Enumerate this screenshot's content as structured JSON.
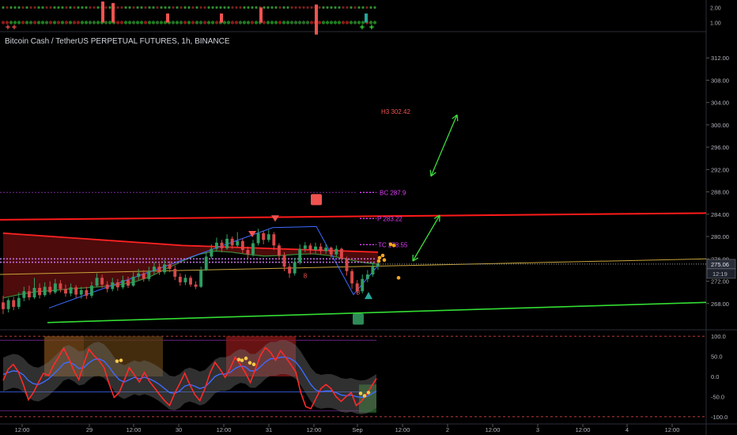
{
  "header": {
    "title": "Bitcoin Cash / TetherUS PERPETUAL FUTURES, 1h, BINANCE"
  },
  "colors": {
    "up": "#26a69a",
    "down": "#ef5350",
    "background": "#000000",
    "pivot": "#e040fb",
    "h3": "#ef5350",
    "ema_long": "#ff1a1a",
    "trend_yellow": "#c8a43a",
    "trend_green": "#33dd33",
    "rsi": "#ff2a2a",
    "rsi_signal": "#3d6bff"
  },
  "chart_data": [
    {
      "type": "bar",
      "name": "indicator-strip",
      "ylim": [
        0.5,
        2.5
      ],
      "y_ticks": [
        "2.00",
        "1.00"
      ],
      "plus_markers": [
        "+",
        "+",
        "+",
        "+"
      ]
    },
    {
      "type": "candlestick",
      "title": "Bitcoin Cash / TetherUS PERPETUAL FUTURES, 1h, BINANCE",
      "ylim": [
        264,
        315
      ],
      "y_ticks": [
        "312.00",
        "308.00",
        "304.00",
        "300.00",
        "296.00",
        "292.00",
        "288.00",
        "284.00",
        "280.00",
        "276.00",
        "272.00",
        "268.00"
      ],
      "x_ticks": [
        "12:00",
        "29",
        "12:00",
        "30",
        "12:00",
        "31",
        "12:00",
        "Sep",
        "12:00",
        "2",
        "12:00",
        "3",
        "12:00",
        "4",
        "12:00"
      ],
      "current_price": {
        "value": 275.06,
        "label": "275.06",
        "countdown": "12:19"
      },
      "levels": [
        {
          "label": "H3 302.42",
          "value": 302.42
        },
        {
          "label": "BC 287.9",
          "value": 287.9
        },
        {
          "label": "P 283.22",
          "value": 283.22
        },
        {
          "label": "TC 278.55",
          "value": 278.55
        }
      ],
      "candles": [
        [
          268.2,
          267.0,
          269.4,
          266.1
        ],
        [
          267.0,
          268.6,
          269.0,
          266.4
        ],
        [
          268.6,
          267.4,
          269.2,
          266.8
        ],
        [
          267.4,
          269.0,
          270.0,
          267.0
        ],
        [
          269.0,
          270.2,
          271.0,
          268.4
        ],
        [
          270.2,
          269.1,
          271.2,
          268.6
        ],
        [
          269.1,
          270.8,
          272.6,
          268.8
        ],
        [
          270.8,
          269.5,
          271.6,
          268.9
        ],
        [
          269.5,
          271.0,
          271.8,
          269.2
        ],
        [
          271.0,
          270.0,
          272.0,
          269.6
        ],
        [
          270.0,
          271.6,
          272.4,
          269.7
        ],
        [
          271.6,
          270.6,
          272.2,
          270.0
        ],
        [
          270.6,
          269.8,
          271.4,
          269.2
        ],
        [
          269.8,
          270.9,
          271.6,
          269.3
        ],
        [
          270.9,
          269.6,
          271.3,
          269.0
        ],
        [
          269.6,
          270.4,
          271.0,
          268.9
        ],
        [
          270.4,
          269.4,
          271.0,
          268.8
        ],
        [
          269.4,
          271.2,
          271.9,
          269.0
        ],
        [
          271.2,
          272.6,
          273.4,
          270.9
        ],
        [
          272.6,
          271.4,
          273.2,
          270.8
        ],
        [
          271.4,
          270.6,
          272.0,
          270.0
        ],
        [
          270.6,
          271.8,
          272.6,
          270.2
        ],
        [
          271.8,
          270.9,
          272.4,
          270.3
        ],
        [
          270.9,
          272.2,
          273.0,
          270.6
        ],
        [
          272.2,
          271.2,
          272.8,
          270.8
        ],
        [
          271.2,
          272.8,
          273.6,
          271.0
        ],
        [
          272.8,
          273.4,
          274.2,
          272.2
        ],
        [
          273.4,
          272.4,
          274.0,
          271.9
        ],
        [
          272.4,
          273.8,
          274.6,
          272.0
        ],
        [
          273.8,
          274.6,
          275.4,
          273.2
        ],
        [
          274.6,
          273.6,
          275.2,
          273.1
        ],
        [
          273.6,
          275.0,
          275.8,
          273.2
        ],
        [
          275.0,
          274.2,
          275.6,
          273.6
        ],
        [
          274.2,
          272.8,
          274.8,
          272.2
        ],
        [
          272.8,
          271.8,
          273.4,
          271.2
        ],
        [
          271.8,
          272.6,
          273.2,
          271.3
        ],
        [
          272.6,
          271.4,
          273.0,
          271.0
        ],
        [
          271.4,
          271.0,
          272.0,
          270.6
        ],
        [
          271.0,
          274.0,
          274.6,
          270.8
        ],
        [
          274.0,
          276.4,
          277.2,
          273.8
        ],
        [
          276.4,
          277.8,
          278.6,
          276.0
        ],
        [
          277.8,
          278.9,
          279.8,
          277.3
        ],
        [
          278.9,
          277.9,
          279.4,
          277.2
        ],
        [
          277.9,
          279.6,
          280.4,
          277.6
        ],
        [
          279.6,
          278.4,
          280.0,
          277.8
        ],
        [
          278.4,
          279.2,
          280.8,
          278.0
        ],
        [
          279.2,
          277.6,
          279.6,
          277.0
        ],
        [
          277.6,
          276.8,
          278.2,
          276.0
        ],
        [
          276.8,
          278.8,
          279.4,
          276.4
        ],
        [
          278.8,
          280.6,
          281.4,
          278.4
        ],
        [
          280.6,
          279.4,
          281.0,
          278.6
        ],
        [
          279.4,
          280.4,
          281.2,
          279.0
        ],
        [
          280.4,
          278.4,
          280.8,
          277.6
        ],
        [
          278.4,
          276.6,
          278.8,
          275.8
        ],
        [
          276.6,
          274.6,
          277.2,
          273.8
        ],
        [
          274.6,
          273.4,
          275.2,
          272.6
        ],
        [
          273.4,
          275.4,
          276.2,
          273.0
        ],
        [
          275.4,
          277.8,
          278.6,
          275.0
        ],
        [
          277.8,
          278.4,
          279.0,
          277.2
        ],
        [
          278.4,
          277.6,
          278.8,
          276.8
        ],
        [
          277.6,
          278.2,
          278.9,
          277.0
        ],
        [
          278.2,
          277.4,
          278.8,
          276.8
        ],
        [
          277.4,
          278.0,
          278.6,
          276.9
        ],
        [
          278.0,
          276.8,
          278.2,
          276.2
        ],
        [
          276.8,
          277.8,
          278.4,
          276.4
        ],
        [
          277.8,
          276.0,
          278.0,
          275.4
        ],
        [
          276.0,
          273.8,
          276.4,
          273.0
        ],
        [
          273.8,
          271.6,
          274.2,
          270.6
        ],
        [
          271.6,
          270.2,
          272.2,
          269.6
        ],
        [
          270.2,
          272.4,
          273.2,
          269.8
        ],
        [
          272.4,
          273.2,
          274.0,
          271.8
        ],
        [
          273.2,
          274.6,
          275.4,
          272.8
        ],
        [
          274.6,
          275.2,
          276.0,
          274.0
        ]
      ],
      "ema_long": [
        280.6,
        280.4,
        280.2,
        280.0,
        279.8,
        279.6,
        279.4,
        279.2,
        279.0,
        278.8,
        278.6,
        278.4,
        278.3,
        278.2,
        278.1,
        278.0,
        277.9,
        277.8,
        277.7,
        277.6,
        277.5,
        277.4,
        277.3,
        277.2
      ],
      "ema_mid": [
        269.0,
        269.6,
        270.1,
        270.3,
        270.6,
        270.8,
        271.0,
        271.3,
        271.8,
        272.8,
        274.2,
        275.6,
        276.8,
        277.4,
        277.2,
        276.8,
        276.5,
        276.6,
        276.8,
        276.9,
        276.6,
        276.0,
        275.4,
        275.0
      ],
      "trend_red": [
        283.0,
        284.2
      ],
      "trend_yellow": [
        273.2,
        276.0
      ],
      "trend_green": [
        264.6,
        268.2
      ],
      "arrows": [
        [
          283.8,
          276.0
        ],
        [
          293.2,
          276.4
        ]
      ],
      "annotations": [
        {
          "type": "sell",
          "label": "8"
        },
        {
          "type": "buy",
          "label": "8"
        },
        {
          "type": "sell",
          "label": ""
        },
        {
          "type": "sell",
          "label": ""
        }
      ]
    },
    {
      "type": "line",
      "name": "rsi-oscillator",
      "ylim": [
        -110,
        110
      ],
      "y_ticks": [
        "100.0",
        "50.0",
        "0.0",
        "-50.0",
        "-100.0"
      ],
      "series": [
        {
          "values": [
            -10,
            18,
            30,
            12,
            -20,
            -58,
            -40,
            -15,
            8,
            2,
            28,
            48,
            70,
            45,
            15,
            -8,
            32,
            68,
            52,
            40,
            22,
            -18,
            -52,
            -40,
            -10,
            22,
            4,
            -14,
            10,
            -12,
            -28,
            -45,
            -60,
            -72,
            -42,
            -18,
            8,
            -20,
            -45,
            -60,
            -30,
            8,
            35,
            18,
            -2,
            20,
            48,
            30,
            10,
            -15,
            18,
            52,
            72,
            60,
            40,
            64,
            48,
            30,
            12,
            -40,
            -75,
            -80,
            -55,
            -30,
            -20,
            -30,
            -50,
            -62,
            -50,
            -40,
            -72,
            -62,
            -45,
            -25,
            -5
          ]
        },
        {
          "values": [
            5,
            10,
            14,
            12,
            4,
            -10,
            -18,
            -20,
            -14,
            -6,
            6,
            18,
            32,
            36,
            30,
            20,
            22,
            34,
            42,
            44,
            38,
            24,
            6,
            -8,
            -14,
            -8,
            -2,
            -6,
            -2,
            -6,
            -12,
            -20,
            -30,
            -40,
            -42,
            -36,
            -24,
            -20,
            -24,
            -30,
            -26,
            -14,
            0,
            6,
            6,
            10,
            20,
            26,
            24,
            14,
            14,
            24,
            36,
            44,
            44,
            48,
            48,
            44,
            36,
            20,
            0,
            -20,
            -34,
            -38,
            -36,
            -36,
            -40,
            -46,
            -48,
            -46,
            -50,
            -52,
            -50,
            -44,
            -36
          ]
        }
      ],
      "dots": [
        38,
        32,
        42,
        -42
      ]
    }
  ]
}
